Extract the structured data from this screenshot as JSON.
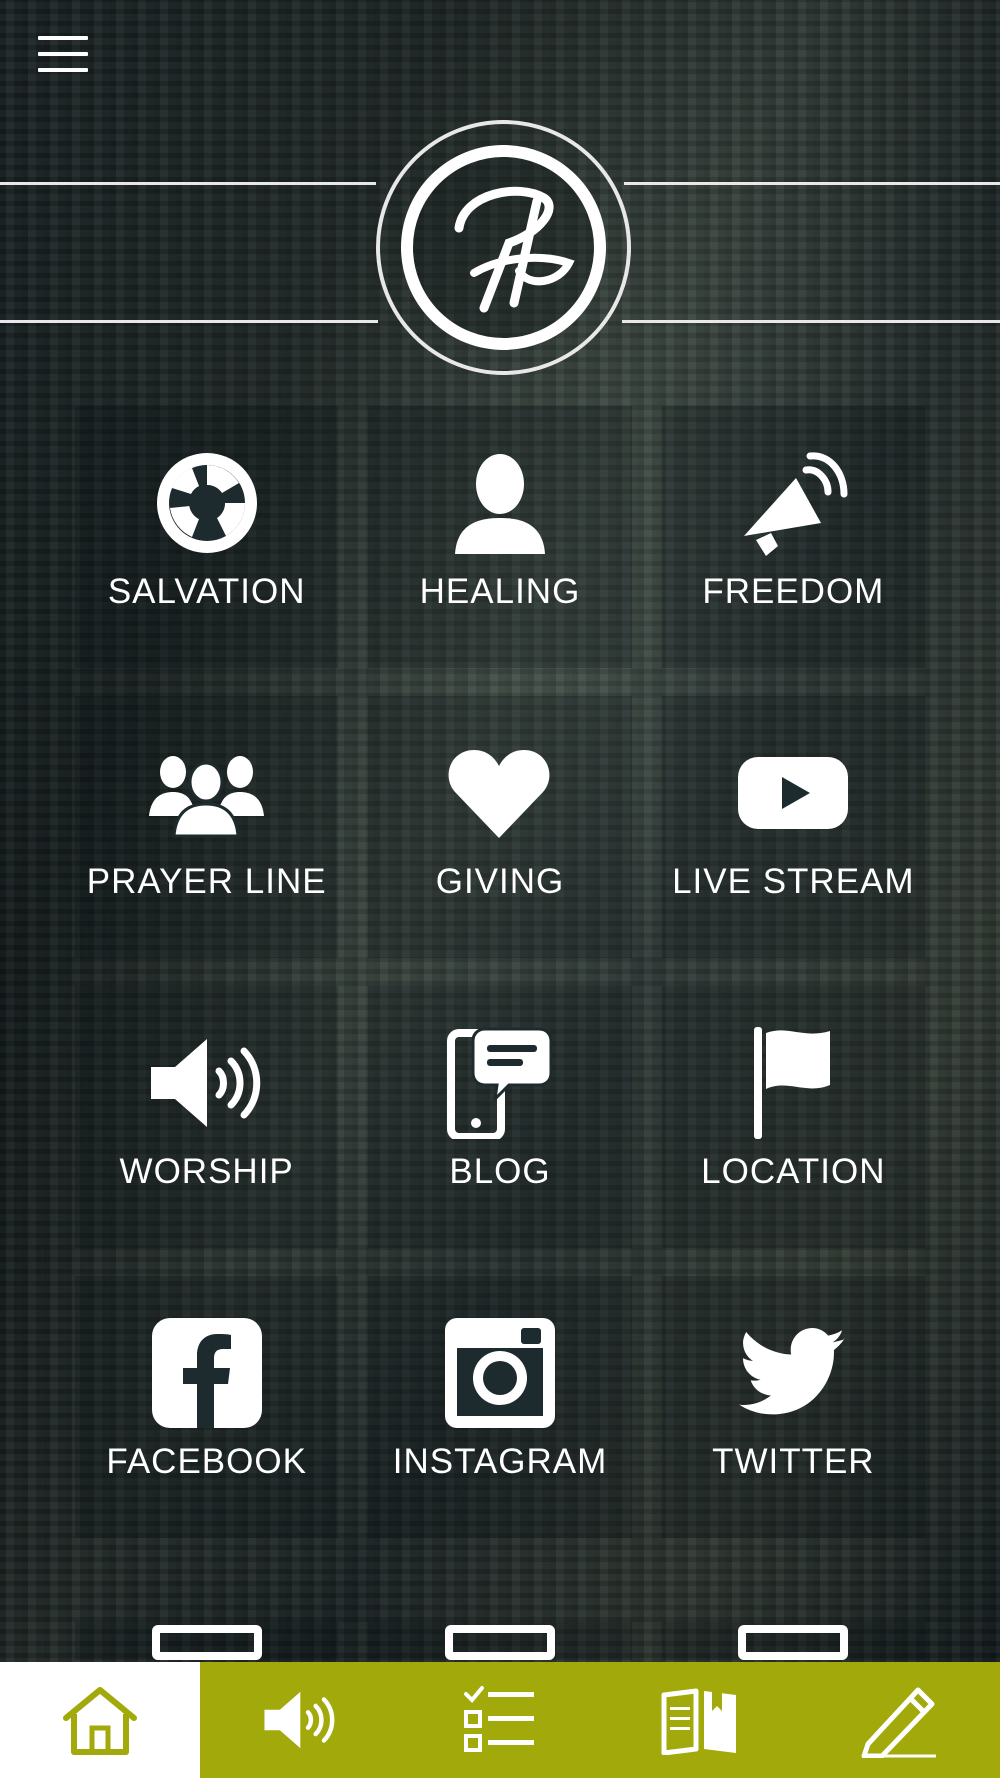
{
  "app": {
    "menu_icon": "hamburger-menu-icon",
    "logo_icon": "church-monogram-logo",
    "accent_color": "#a2a90a"
  },
  "tiles": [
    {
      "label": "SALVATION",
      "icon": "lifebuoy-icon"
    },
    {
      "label": "HEALING",
      "icon": "person-icon"
    },
    {
      "label": "FREEDOM",
      "icon": "megaphone-icon"
    },
    {
      "label": "PRAYER LINE",
      "icon": "group-icon"
    },
    {
      "label": "GIVING",
      "icon": "heart-icon"
    },
    {
      "label": "LIVE STREAM",
      "icon": "youtube-icon"
    },
    {
      "label": "WORSHIP",
      "icon": "speaker-icon"
    },
    {
      "label": "BLOG",
      "icon": "phone-chat-icon"
    },
    {
      "label": "LOCATION",
      "icon": "flag-icon"
    },
    {
      "label": "FACEBOOK",
      "icon": "facebook-icon"
    },
    {
      "label": "INSTAGRAM",
      "icon": "instagram-icon"
    },
    {
      "label": "TWITTER",
      "icon": "twitter-icon"
    }
  ],
  "tabbar": [
    {
      "icon": "home-icon",
      "active": true
    },
    {
      "icon": "speaker-icon",
      "active": false
    },
    {
      "icon": "checklist-icon",
      "active": false
    },
    {
      "icon": "book-icon",
      "active": false
    },
    {
      "icon": "pencil-icon",
      "active": false
    }
  ]
}
